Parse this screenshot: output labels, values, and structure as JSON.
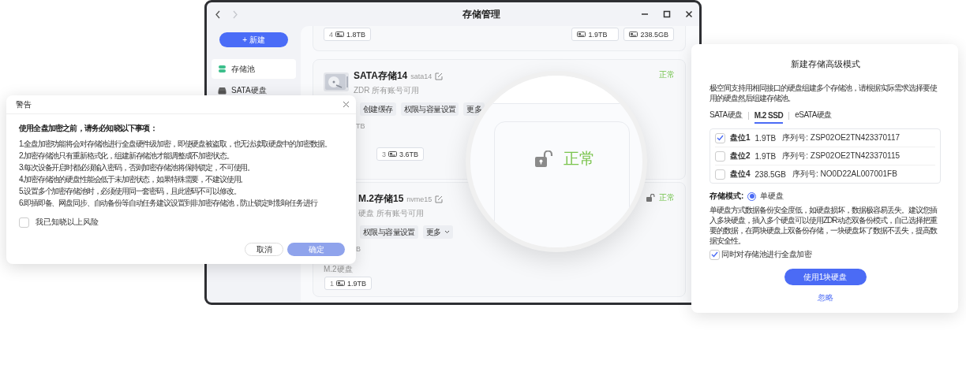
{
  "main_window": {
    "title": "存储管理",
    "sidebar": {
      "new_button": "+ 新建",
      "items": [
        {
          "label": "存储池",
          "kind": "pool",
          "selected": true
        },
        {
          "label": "SATA硬盘",
          "kind": "drive",
          "selected": false
        }
      ]
    },
    "pools": [
      {
        "kind": "tail",
        "chips": [
          {
            "slot": "4",
            "size": "1.8TB"
          }
        ],
        "right_chips": [
          {
            "size": "1.9TB"
          },
          {
            "size": "238.5GB"
          }
        ]
      },
      {
        "kind": "full",
        "name": "SATA存储14",
        "id": "sata14",
        "subtitle": "ZDR  所有账号可用",
        "status": "正常",
        "lock_shown": false,
        "actions": [
          {
            "label": "创建缓存",
            "dropdown": false
          },
          {
            "label": "权限与容量设置",
            "dropdown": false
          },
          {
            "label": "更多",
            "dropdown": false
          }
        ],
        "caption": "TB",
        "chips": [
          {
            "slot": "3",
            "size": "3.6TB"
          }
        ]
      },
      {
        "kind": "covered",
        "name": "M.2存储15",
        "id": "nvme15",
        "subtitle": "硬盘  所有账号可用",
        "status": "正常",
        "lock_shown": true,
        "actions": [
          {
            "label": "权限与容量设置",
            "dropdown": false
          },
          {
            "label": "更多",
            "dropdown": true
          }
        ],
        "caption": "B",
        "group_label": "M.2硬盘",
        "chips": [
          {
            "slot": "1",
            "size": "1.9TB"
          }
        ]
      }
    ]
  },
  "magnifier": {
    "status": "正常",
    "lock_shown": true
  },
  "dialog": {
    "title": "警告",
    "heading": "使用全盘加密之前，请务必知晓以下事项：",
    "items": [
      "1.全盘加密功能将会对存储池进行全盘硬件级加密，即使硬盘被盗取，也无法读取硬盘中的加密数据。",
      "2.加密存储池只有重新格式化，组建新存储池才能调整成不加密状态。",
      "3.每次设备开启时都必须输入密码，否则加密存储池将保持锁定，不可使用。",
      "4.加密存储池的硬盘性能会低于未加密状态，如果特殊需要，不建议使用。",
      "5.设置多个加密存储池时，必须使用同一套密码，且此密码不可以修改。",
      "6.即插即备、网盘同步、自动备份等自动任务建议设置到非加密存储池，防止锁定时影响任务进行"
    ],
    "agree": {
      "label": "我已知晓以上风险",
      "checked": false
    },
    "buttons": [
      {
        "label": "取消",
        "kind": "secondary"
      },
      {
        "label": "确定",
        "kind": "primary",
        "disabled": true
      }
    ]
  },
  "panel": {
    "title": "新建存储高级模式",
    "description": "极空间支持用相同接口的硬盘组建多个存储池，请根据实际需求选择要使用的硬盘然后组建存储池。",
    "tabs": [
      {
        "label": "SATA硬盘",
        "selected": false
      },
      {
        "label": "M.2 SSD",
        "selected": true
      },
      {
        "label": "eSATA硬盘",
        "selected": false
      }
    ],
    "disks": [
      {
        "slot": "盘位1",
        "size": "1.9TB",
        "serial": "序列号: ZSP02OE2TN423370117",
        "checked": true
      },
      {
        "slot": "盘位2",
        "size": "1.9TB",
        "serial": "序列号: ZSP02OE2TN423370115",
        "checked": false
      },
      {
        "slot": "盘位4",
        "size": "238.5GB",
        "serial": "序列号: NO0D22AL007001FB",
        "checked": false
      }
    ],
    "mode_label": "存储模式:",
    "mode": {
      "label": "单硬盘",
      "selected": true
    },
    "mode_description": "单硬盘方式数据备份安全度低，如硬盘损坏，数据极容易丢失。建议您插入多块硬盘，插入多个硬盘可以使用ZDR动态双备份模式，自己选择把重要的数据，在两块硬盘上双备份存储，一块硬盘坏了数据不丢失，提高数据安全性。",
    "encrypt": {
      "label": "同时对存储池进行全盘加密",
      "checked": true
    },
    "confirm_button": "使用1块硬盘",
    "skip_link": "忽略"
  }
}
